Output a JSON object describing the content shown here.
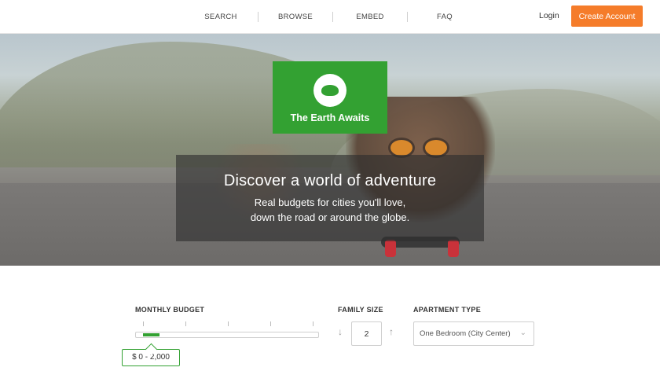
{
  "nav": {
    "items": [
      "SEARCH",
      "BROWSE",
      "EMBED",
      "FAQ"
    ],
    "login": "Login",
    "create_account": "Create Account"
  },
  "hero": {
    "logo_text": "The Earth Awaits",
    "title": "Discover a world of adventure",
    "subtitle_line1": "Real budgets for cities you'll love,",
    "subtitle_line2": "down the road or around the globe."
  },
  "filters": {
    "monthly_budget_label": "MONTHLY BUDGET",
    "budget_value": "$ 0 - 2,000",
    "budget_slider_fill_fraction": 0.1,
    "family_size_label": "FAMILY SIZE",
    "family_size_value": "2",
    "apartment_type_label": "APARTMENT TYPE",
    "apartment_type_value": "One Bedroom (City Center)",
    "down_arrow": "↓",
    "up_arrow": "↑",
    "chevron": "⌄"
  },
  "colors": {
    "brand_green": "#33a132",
    "cta_orange": "#f57c2a"
  },
  "icons": [
    "earth-hands-icon",
    "arrow-down-icon",
    "arrow-up-icon",
    "chevron-down-icon"
  ]
}
